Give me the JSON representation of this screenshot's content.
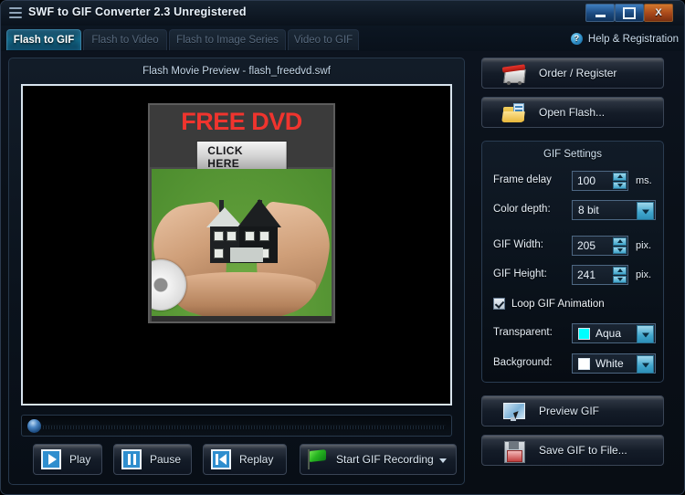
{
  "window": {
    "title": "SWF to GIF Converter 2.3 Unregistered",
    "menu_icon": "hamburger-icon",
    "minimize_label": "–",
    "maximize_label": "□",
    "close_label": "X"
  },
  "tabs": [
    {
      "label": "Flash to GIF",
      "active": true
    },
    {
      "label": "Flash to Video",
      "active": false
    },
    {
      "label": "Flash to Image Series",
      "active": false
    },
    {
      "label": "Video to GIF",
      "active": false
    }
  ],
  "help": {
    "label": "Help & Registration",
    "icon": "question-icon",
    "badge": "?"
  },
  "preview": {
    "title": "Flash Movie Preview - flash_freedvd.swf",
    "ad": {
      "headline": "FREE DVD",
      "cta": "CLICK HERE"
    }
  },
  "transport": {
    "play": "Play",
    "pause": "Pause",
    "replay": "Replay",
    "record": "Start GIF Recording"
  },
  "actions": {
    "order": "Order / Register",
    "open": "Open Flash...",
    "preview_gif": "Preview GIF",
    "save_gif": "Save GIF to File..."
  },
  "gif_settings": {
    "group_title": "GIF Settings",
    "frame_delay": {
      "label": "Frame delay",
      "value": "100",
      "unit": "ms."
    },
    "color_depth": {
      "label": "Color depth:",
      "value": "8 bit"
    },
    "gif_width": {
      "label": "GIF Width:",
      "value": "205",
      "unit": "pix."
    },
    "gif_height": {
      "label": "GIF Height:",
      "value": "241",
      "unit": "pix."
    },
    "loop": {
      "label": "Loop GIF Animation",
      "checked": true
    },
    "transparent": {
      "label": "Transparent:",
      "value": "Aqua",
      "color": "#00ffff"
    },
    "background": {
      "label": "Background:",
      "value": "White",
      "color": "#ffffff"
    }
  },
  "colors": {
    "accent": "#2f8ece",
    "panel": "#0b131d",
    "border": "#27384b",
    "close_button": "#a8481a",
    "headline_red": "#f0342e",
    "flag_green": "#27b521"
  }
}
